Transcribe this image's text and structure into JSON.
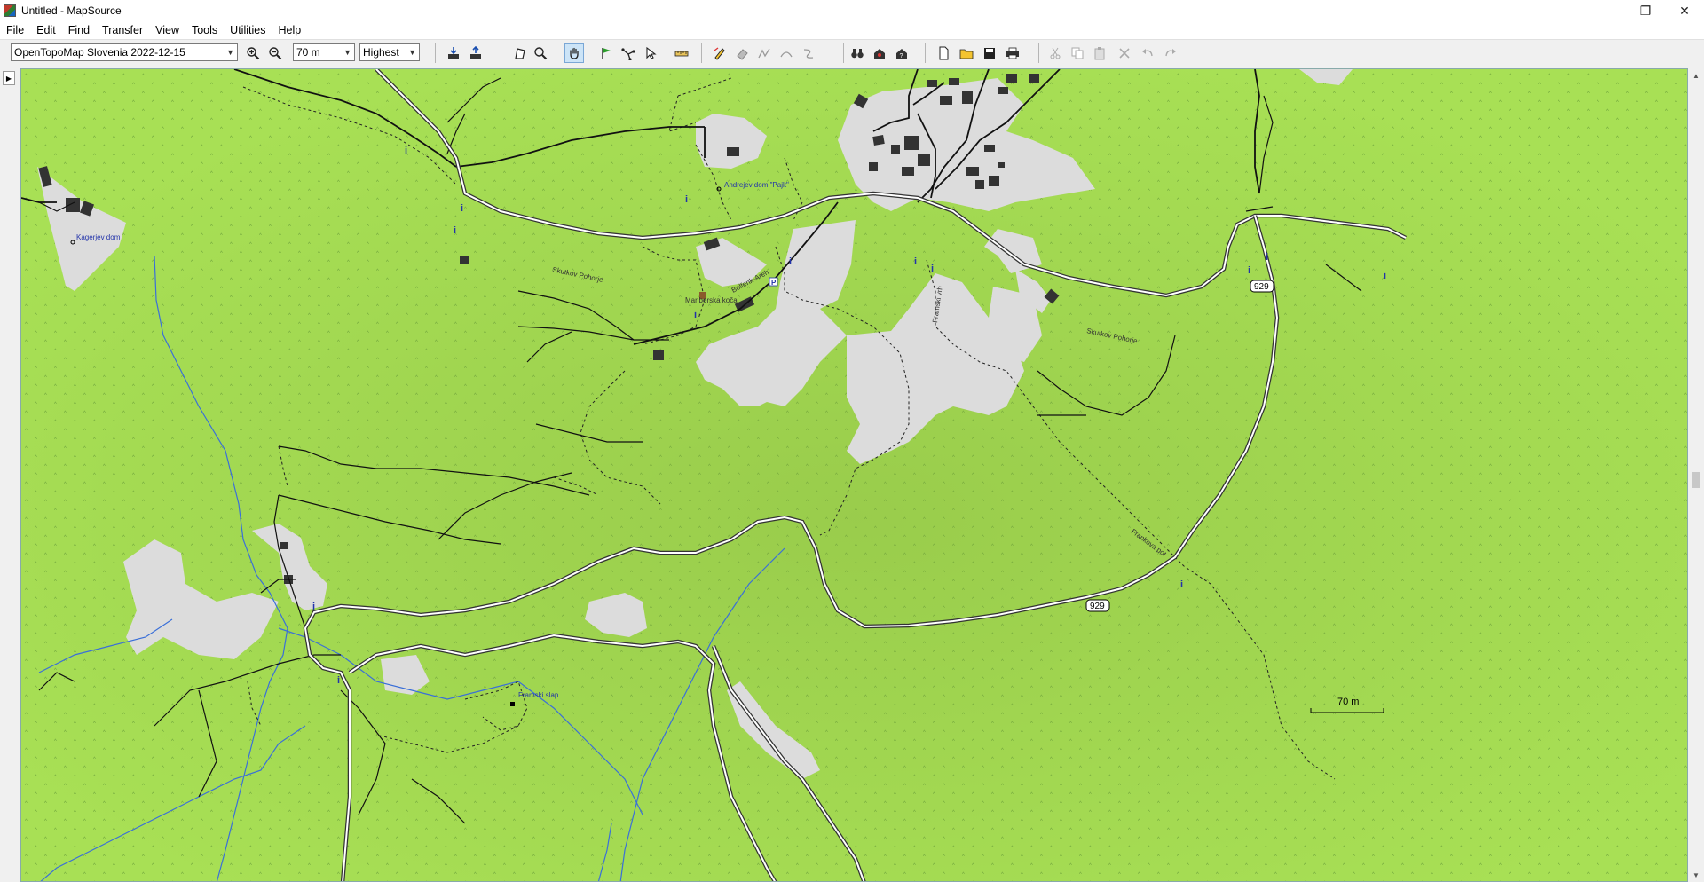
{
  "window": {
    "title": "Untitled - MapSource"
  },
  "menu": {
    "items": [
      "File",
      "Edit",
      "Find",
      "Transfer",
      "View",
      "Tools",
      "Utilities",
      "Help"
    ]
  },
  "toolbar": {
    "map_product": "OpenTopoMap Slovenia 2022-12-15",
    "zoom_scale": "70 m",
    "detail": "Highest"
  },
  "map": {
    "labels": {
      "kagerjev_dom": "Kagerjev dom",
      "andrejev_dom": "Andrejev dom \"Pajk\"",
      "mariborska_koca": "Mariborska koča",
      "framski_slap": "Framski slap",
      "road_1": "Skutkov Pohorje",
      "road_2": "Skutkov Pohorje",
      "road_3": "Bolfenk-Areh",
      "road_4": "Framski vrh",
      "road_5": "Frankova pot",
      "parking": "P"
    },
    "route_shield_1": "929",
    "route_shield_2": "929",
    "scale_bar": "70 m"
  },
  "colors": {
    "map_green": "#a6e050",
    "urban_grey": "#dcdcdc",
    "building": "#333333",
    "water": "#3a6fd8"
  }
}
